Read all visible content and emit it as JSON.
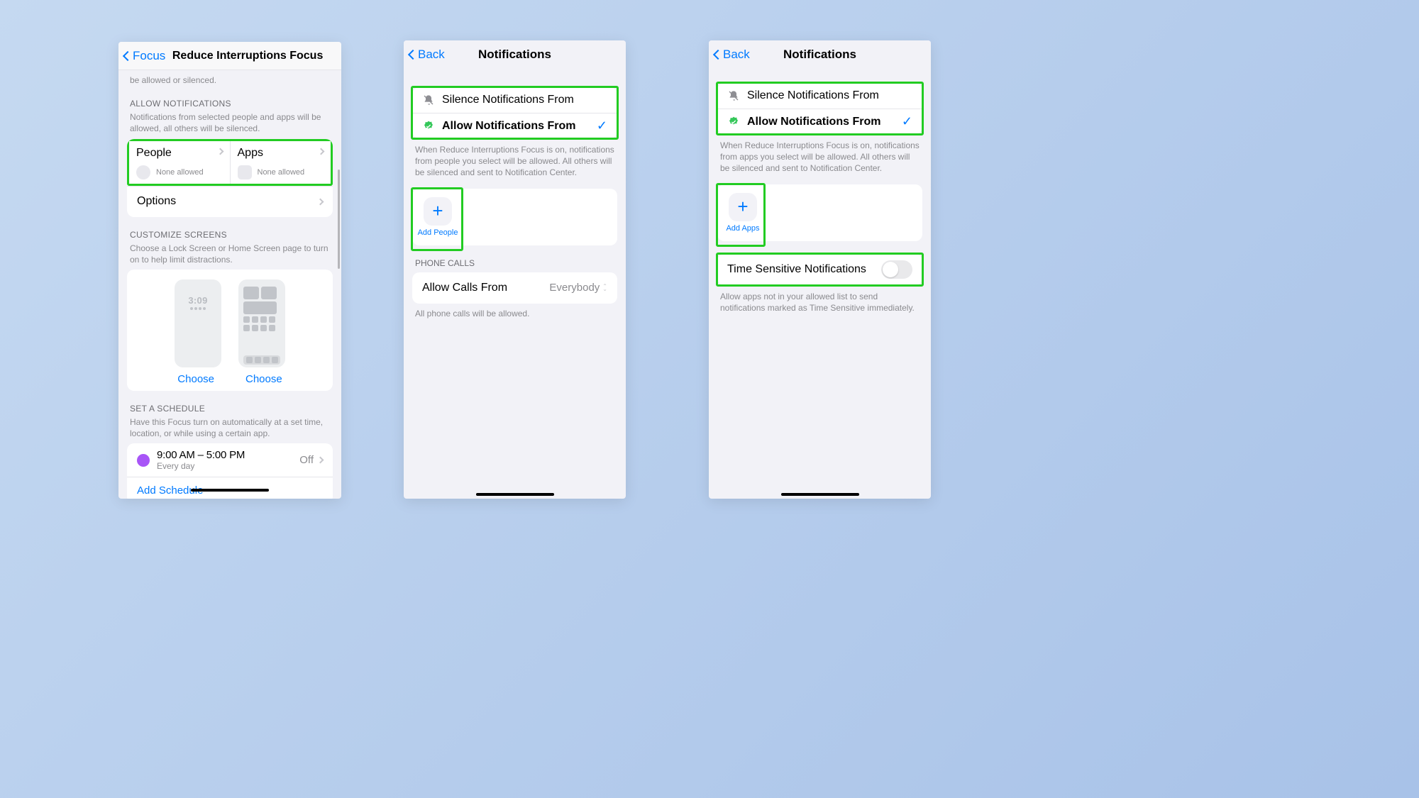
{
  "phone1": {
    "back": "Focus",
    "title": "Reduce Interruptions Focus",
    "truncated_help": "be allowed or silenced.",
    "allow_header": "ALLOW NOTIFICATIONS",
    "allow_desc": "Notifications from selected people and apps will be allowed, all others will be silenced.",
    "people_label": "People",
    "people_status": "None allowed",
    "apps_label": "Apps",
    "apps_status": "None allowed",
    "options_label": "Options",
    "customize_header": "CUSTOMIZE SCREENS",
    "customize_desc": "Choose a Lock Screen or Home Screen page to turn on to help limit distractions.",
    "lock_time": "3:09",
    "choose_label": "Choose",
    "schedule_header": "SET A SCHEDULE",
    "schedule_desc": "Have this Focus turn on automatically at a set time, location, or while using a certain app.",
    "schedule_times": "9:00 AM – 5:00 PM",
    "schedule_sub": "Every day",
    "schedule_state": "Off",
    "add_schedule": "Add Schedule"
  },
  "phone2": {
    "back": "Back",
    "title": "Notifications",
    "silence_label": "Silence Notifications From",
    "allow_label": "Allow Notifications From",
    "help": "When Reduce Interruptions Focus is on, notifications from people you select will be allowed. All others will be silenced and sent to Notification Center.",
    "add_caption": "Add People",
    "calls_header": "PHONE CALLS",
    "calls_label": "Allow Calls From",
    "calls_value": "Everybody",
    "calls_help": "All phone calls will be allowed."
  },
  "phone3": {
    "back": "Back",
    "title": "Notifications",
    "silence_label": "Silence Notifications From",
    "allow_label": "Allow Notifications From",
    "help": "When Reduce Interruptions Focus is on, notifications from apps you select will be allowed. All others will be silenced and sent to Notification Center.",
    "add_caption": "Add Apps",
    "ts_label": "Time Sensitive Notifications",
    "ts_help": "Allow apps not in your allowed list to send notifications marked as Time Sensitive immediately."
  }
}
